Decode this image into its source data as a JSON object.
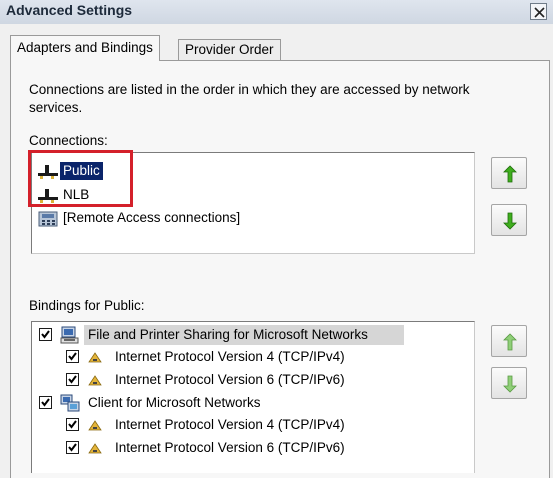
{
  "window": {
    "title": "Advanced Settings"
  },
  "tabs": [
    {
      "label": "Adapters and Bindings",
      "active": true
    },
    {
      "label": "Provider Order",
      "active": false
    }
  ],
  "description": "Connections are listed in the order in which they are accessed by network services.",
  "connections": {
    "label": "Connections:",
    "items": [
      {
        "label": "Public",
        "icon": "network-adapter-icon",
        "selected": true
      },
      {
        "label": "NLB",
        "icon": "network-adapter-icon",
        "selected": false
      },
      {
        "label": "[Remote Access connections]",
        "icon": "phone-modem-icon",
        "selected": false
      }
    ]
  },
  "bindings": {
    "label": "Bindings for Public:",
    "items": [
      {
        "label": "File and Printer Sharing for Microsoft Networks",
        "level": 0,
        "checked": true,
        "icon": "file-printer-sharing-icon",
        "highlighted": true
      },
      {
        "label": "Internet Protocol Version 4 (TCP/IPv4)",
        "level": 1,
        "checked": true,
        "icon": "protocol-icon"
      },
      {
        "label": "Internet Protocol Version 6 (TCP/IPv6)",
        "level": 1,
        "checked": true,
        "icon": "protocol-icon"
      },
      {
        "label": "Client for Microsoft Networks",
        "level": 0,
        "checked": true,
        "icon": "network-client-icon"
      },
      {
        "label": "Internet Protocol Version 4 (TCP/IPv4)",
        "level": 1,
        "checked": true,
        "icon": "protocol-icon"
      },
      {
        "label": "Internet Protocol Version 6 (TCP/IPv6)",
        "level": 1,
        "checked": true,
        "icon": "protocol-icon"
      }
    ]
  },
  "colors": {
    "selection": "#0a246a",
    "annotation_box": "#d4202a",
    "arrow_green": "#3fae1e"
  }
}
